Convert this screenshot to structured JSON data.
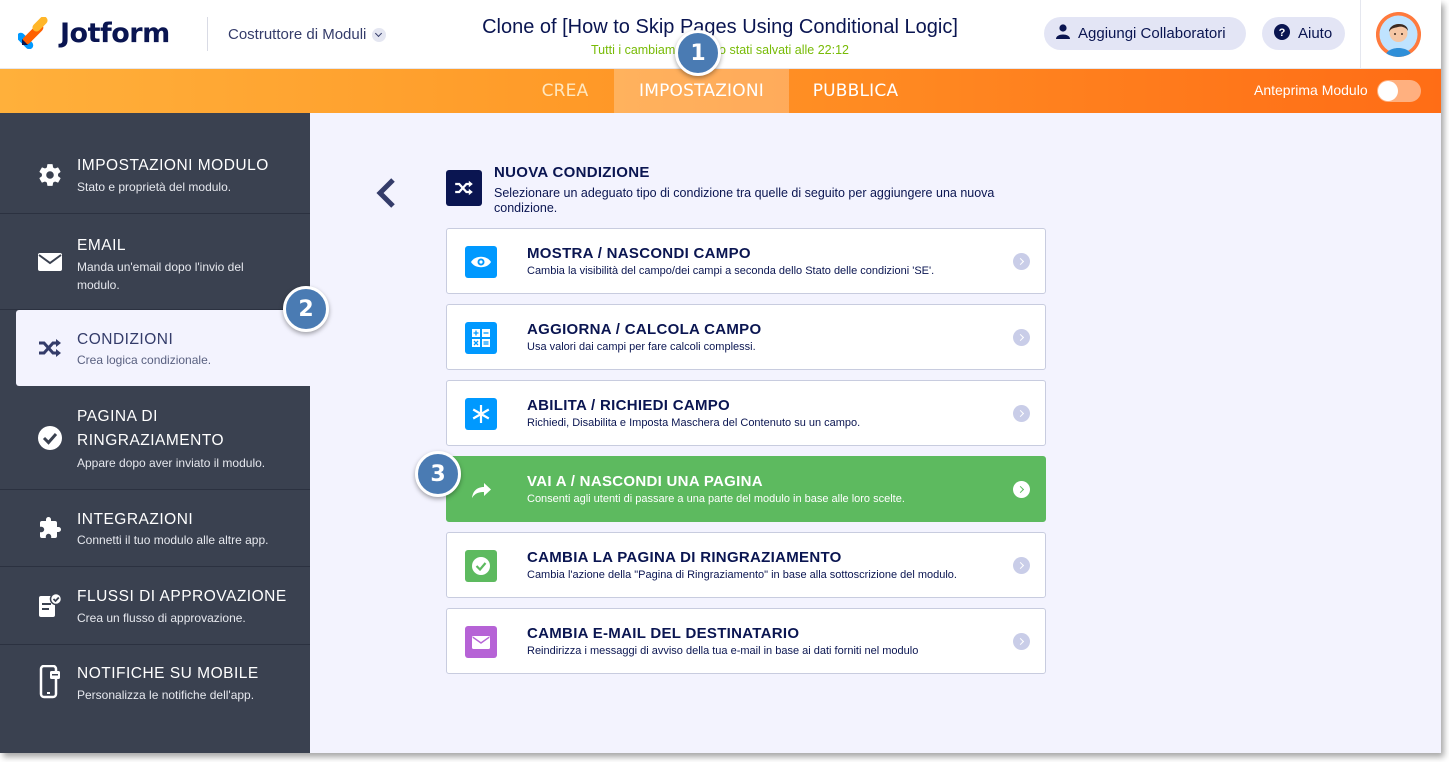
{
  "header": {
    "brand": "Jotform",
    "builder_label": "Costruttore di Moduli",
    "form_title": "Clone of [How to Skip Pages Using Conditional Logic]",
    "save_status": "Tutti i cambiamenti sono stati salvati alle 22:12",
    "collaborators_label": "Aggiungi Collaboratori",
    "help_label": "Aiuto"
  },
  "nav": {
    "tabs": [
      {
        "label": "CREA"
      },
      {
        "label": "IMPOSTAZIONI",
        "active": true
      },
      {
        "label": "PUBBLICA"
      }
    ],
    "preview_label": "Anteprima Modulo",
    "preview_on": false
  },
  "sidebar": {
    "items": [
      {
        "title": "IMPOSTAZIONI MODULO",
        "desc": "Stato e proprietà del modulo.",
        "icon": "gear-icon"
      },
      {
        "title": "EMAIL",
        "desc": "Manda un'email dopo l'invio del modulo.",
        "icon": "envelope-icon"
      },
      {
        "title": "CONDIZIONI",
        "desc": "Crea logica condizionale.",
        "icon": "shuffle-icon",
        "active": true
      },
      {
        "title": "PAGINA DI RINGRAZIAMENTO",
        "desc": "Appare dopo aver inviato il modulo.",
        "icon": "check-circle-icon"
      },
      {
        "title": "INTEGRAZIONI",
        "desc": "Connetti il tuo modulo alle altre app.",
        "icon": "puzzle-icon"
      },
      {
        "title": "FLUSSI DI APPROVAZIONE",
        "desc": "Crea un flusso di approvazione.",
        "icon": "approval-icon"
      },
      {
        "title": "NOTIFICHE SU MOBILE",
        "desc": "Personalizza le notifiche dell'app.",
        "icon": "mobile-icon"
      }
    ]
  },
  "main": {
    "section_title": "NUOVA CONDIZIONE",
    "section_desc": "Selezionare un adeguato tipo di condizione tra quelle di seguito per aggiungere una nuova condizione.",
    "conditions": [
      {
        "title": "MOSTRA / NASCONDI CAMPO",
        "desc": "Cambia la visibilità del campo/dei campi a seconda dello Stato delle condizioni 'SE'.",
        "icon": "eye-icon",
        "color": "#0099ff"
      },
      {
        "title": "AGGIORNA / CALCOLA CAMPO",
        "desc": "Usa valori dai campi per fare calcoli complessi.",
        "icon": "calculator-icon",
        "color": "#0099ff"
      },
      {
        "title": "ABILITA / RICHIEDI CAMPO",
        "desc": "Richiedi, Disabilita e Imposta Maschera del Contenuto su un campo.",
        "icon": "asterisk-icon",
        "color": "#0099ff"
      },
      {
        "title": "VAI A / NASCONDI UNA PAGINA",
        "desc": "Consenti agli utenti di passare a una parte del modulo in base alle loro scelte.",
        "icon": "share-arrow-icon",
        "color": "#5dba5f",
        "highlight": true
      },
      {
        "title": "CAMBIA LA PAGINA DI RINGRAZIAMENTO",
        "desc": "Cambia l'azione della \"Pagina di Ringraziamento\" in base alla sottoscrizione del modulo.",
        "icon": "check-icon",
        "color": "#5dba5f"
      },
      {
        "title": "CAMBIA E-MAIL DEL DESTINATARIO",
        "desc": "Reindirizza i messaggi di avviso della tua e-mail in base ai dati forniti nel modulo",
        "icon": "envelope-icon",
        "color": "#b663d6"
      }
    ]
  },
  "badges": [
    "1",
    "2",
    "3"
  ],
  "colors": {
    "navy": "#0a1551",
    "orange": "#ff7b1c",
    "sidebar": "#3a4150",
    "green": "#5dba5f",
    "blue": "#0099ff",
    "purple": "#b663d6"
  }
}
